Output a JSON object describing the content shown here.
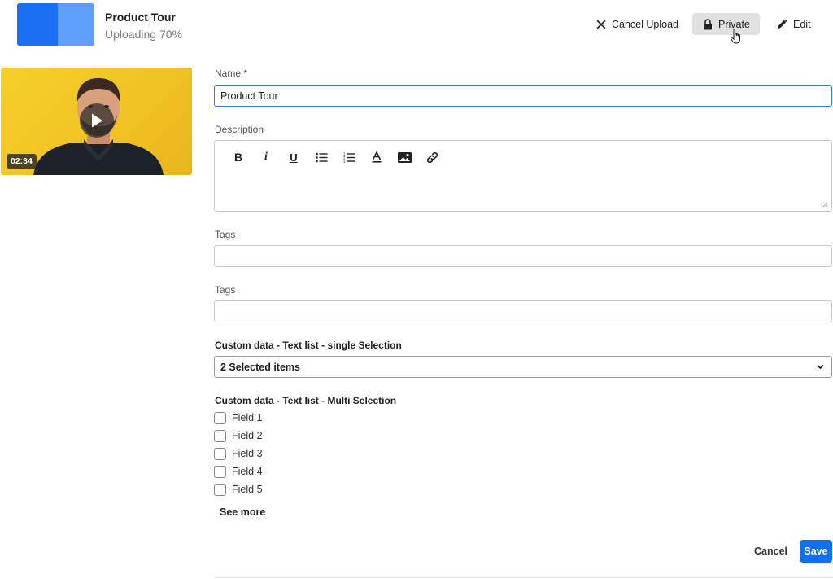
{
  "header": {
    "title": "Product Tour",
    "status": "Uploading 70%",
    "progress_percent": 70,
    "cancel_upload_label": "Cancel Upload",
    "private_label": "Private",
    "edit_label": "Edit"
  },
  "video": {
    "duration": "02:34",
    "background_color": "#f2c526"
  },
  "form": {
    "name_label": "Name *",
    "name_value": "Product Tour",
    "description_label": "Description",
    "toolbar": [
      "bold-icon",
      "italic-icon",
      "underline-icon",
      "bullet-list-icon",
      "numbered-list-icon",
      "text-color-icon",
      "image-icon",
      "link-icon"
    ],
    "tags1_label": "Tags",
    "tags2_label": "Tags",
    "single_select_label": "Custom data - Text list -  single Selection",
    "single_select_value": "2 Selected items",
    "multi_select_label": "Custom data - Text list -  Multi  Selection",
    "fields": [
      "Field 1",
      "Field 2",
      "Field 3",
      "Field 4",
      "Field 5"
    ],
    "see_more_label": "See more"
  },
  "footer": {
    "cancel_label": "Cancel",
    "save_label": "Save"
  },
  "colors": {
    "primary": "#1070f0",
    "focus_border": "#2b7de9",
    "private_bg": "#e1e1e1"
  }
}
